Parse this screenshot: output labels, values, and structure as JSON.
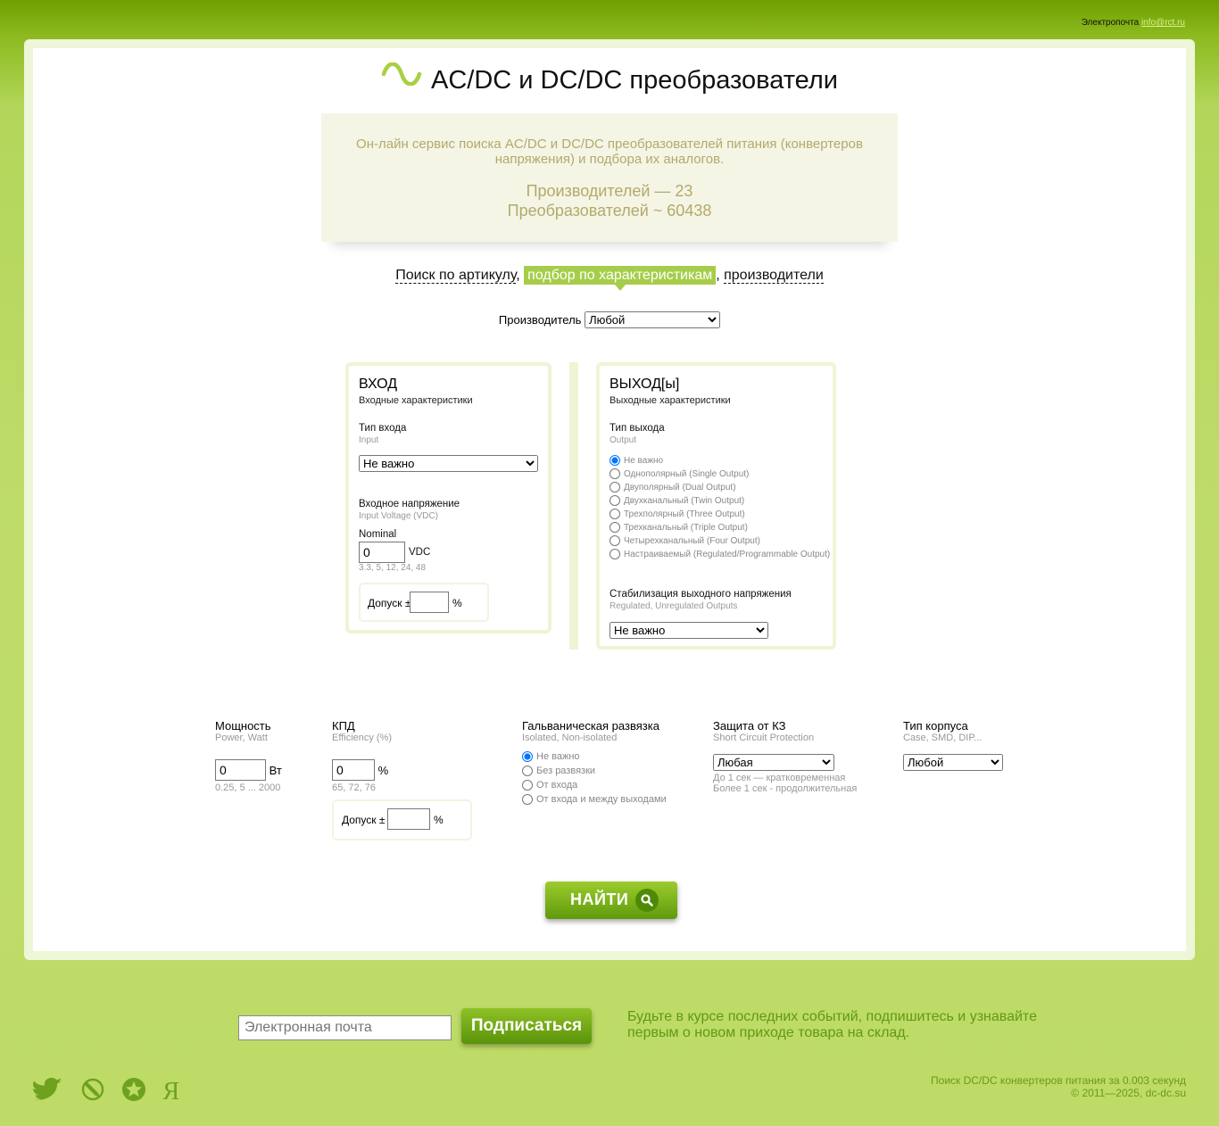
{
  "header": {
    "email_label": "Электропочта",
    "email": "info@rct.ru"
  },
  "title": "AC/DC и DC/DC преобразователи",
  "intro": {
    "description": "Он-лайн сервис поиска AC/DC и DC/DC преобразователей питания (конвертеров напряжения) и подбора их аналогов.",
    "manufacturers": "Производителей — 23",
    "converters": "Преобразователей ~ 60438"
  },
  "modes": {
    "by_article": "Поиск по артикулу",
    "by_params": "подбор по характеристикам",
    "manufacturers": "производители"
  },
  "manufacturer": {
    "label": "Производитель",
    "selected": "Любой"
  },
  "input": {
    "title": "ВХОД",
    "subtitle": "Входные характеристики",
    "type_label": "Тип входа",
    "type_hint": "Input",
    "type_selected": "Не важно",
    "voltage_label": "Входное напряжение",
    "voltage_hint": "Input Voltage (VDC)",
    "nominal_label": "Nominal",
    "nominal_value": "0",
    "unit": "VDC",
    "examples": "3.3, 5, 12, 24, 48",
    "tolerance_label": "Допуск ±",
    "tolerance_unit": "%"
  },
  "output": {
    "title": "ВЫХОД[ы]",
    "subtitle": "Выходные характеристики",
    "type_label": "Тип выхода",
    "type_hint": "Output",
    "options": [
      "Не важно",
      "Однополярный (Single Output)",
      "Двуполярный (Dual Output)",
      "Двухканальный (Twin Output)",
      "Трехполярный (Three Output)",
      "Трехканальный (Triple Output)",
      "Четырехканальный (Four Output)",
      "Настраиваемый (Regulated/Programmable Output)"
    ],
    "stab_label": "Стабилизация выходного напряжения",
    "stab_hint": "Regulated, Unregulated Outputs",
    "stab_selected": "Не важно"
  },
  "power": {
    "label": "Мощность",
    "hint": "Power, Watt",
    "value": "0",
    "unit": "Вт",
    "examples": "0.25, 5 ... 2000"
  },
  "efficiency": {
    "label": "КПД",
    "hint": "Efficiency (%)",
    "value": "0",
    "unit": "%",
    "examples": "65, 72, 76",
    "tolerance_label": "Допуск ±",
    "tolerance_unit": "%"
  },
  "isolation": {
    "label": "Гальваническая развязка",
    "hint": "Isolated, Non-isolated",
    "options": [
      "Не важно",
      "Без развязки",
      "От входа",
      "От входа и между выходами"
    ]
  },
  "protection": {
    "label": "Защита от КЗ",
    "hint": "Short Circuit Protection",
    "selected": "Любая",
    "note1": "До 1 сек — кратковременная",
    "note2": "Более 1 сек - продолжительная"
  },
  "package": {
    "label": "Тип корпуса",
    "hint": "Case, SMD, DIP...",
    "selected": "Любой"
  },
  "find_button": "НАЙТИ",
  "footer": {
    "email_placeholder": "Электронная почта",
    "subscribe": "Подписаться",
    "subscribe_text": "Будьте в курсе последних событий, подпишитесь и узнавайте первым о новом приходе товара на склад.",
    "search_time": "Поиск DC/DC конвертеров питания за 0.003 секунд",
    "copyright": "© 2011—2025, dc-dc.su",
    "yandex_glyph": "Я"
  }
}
